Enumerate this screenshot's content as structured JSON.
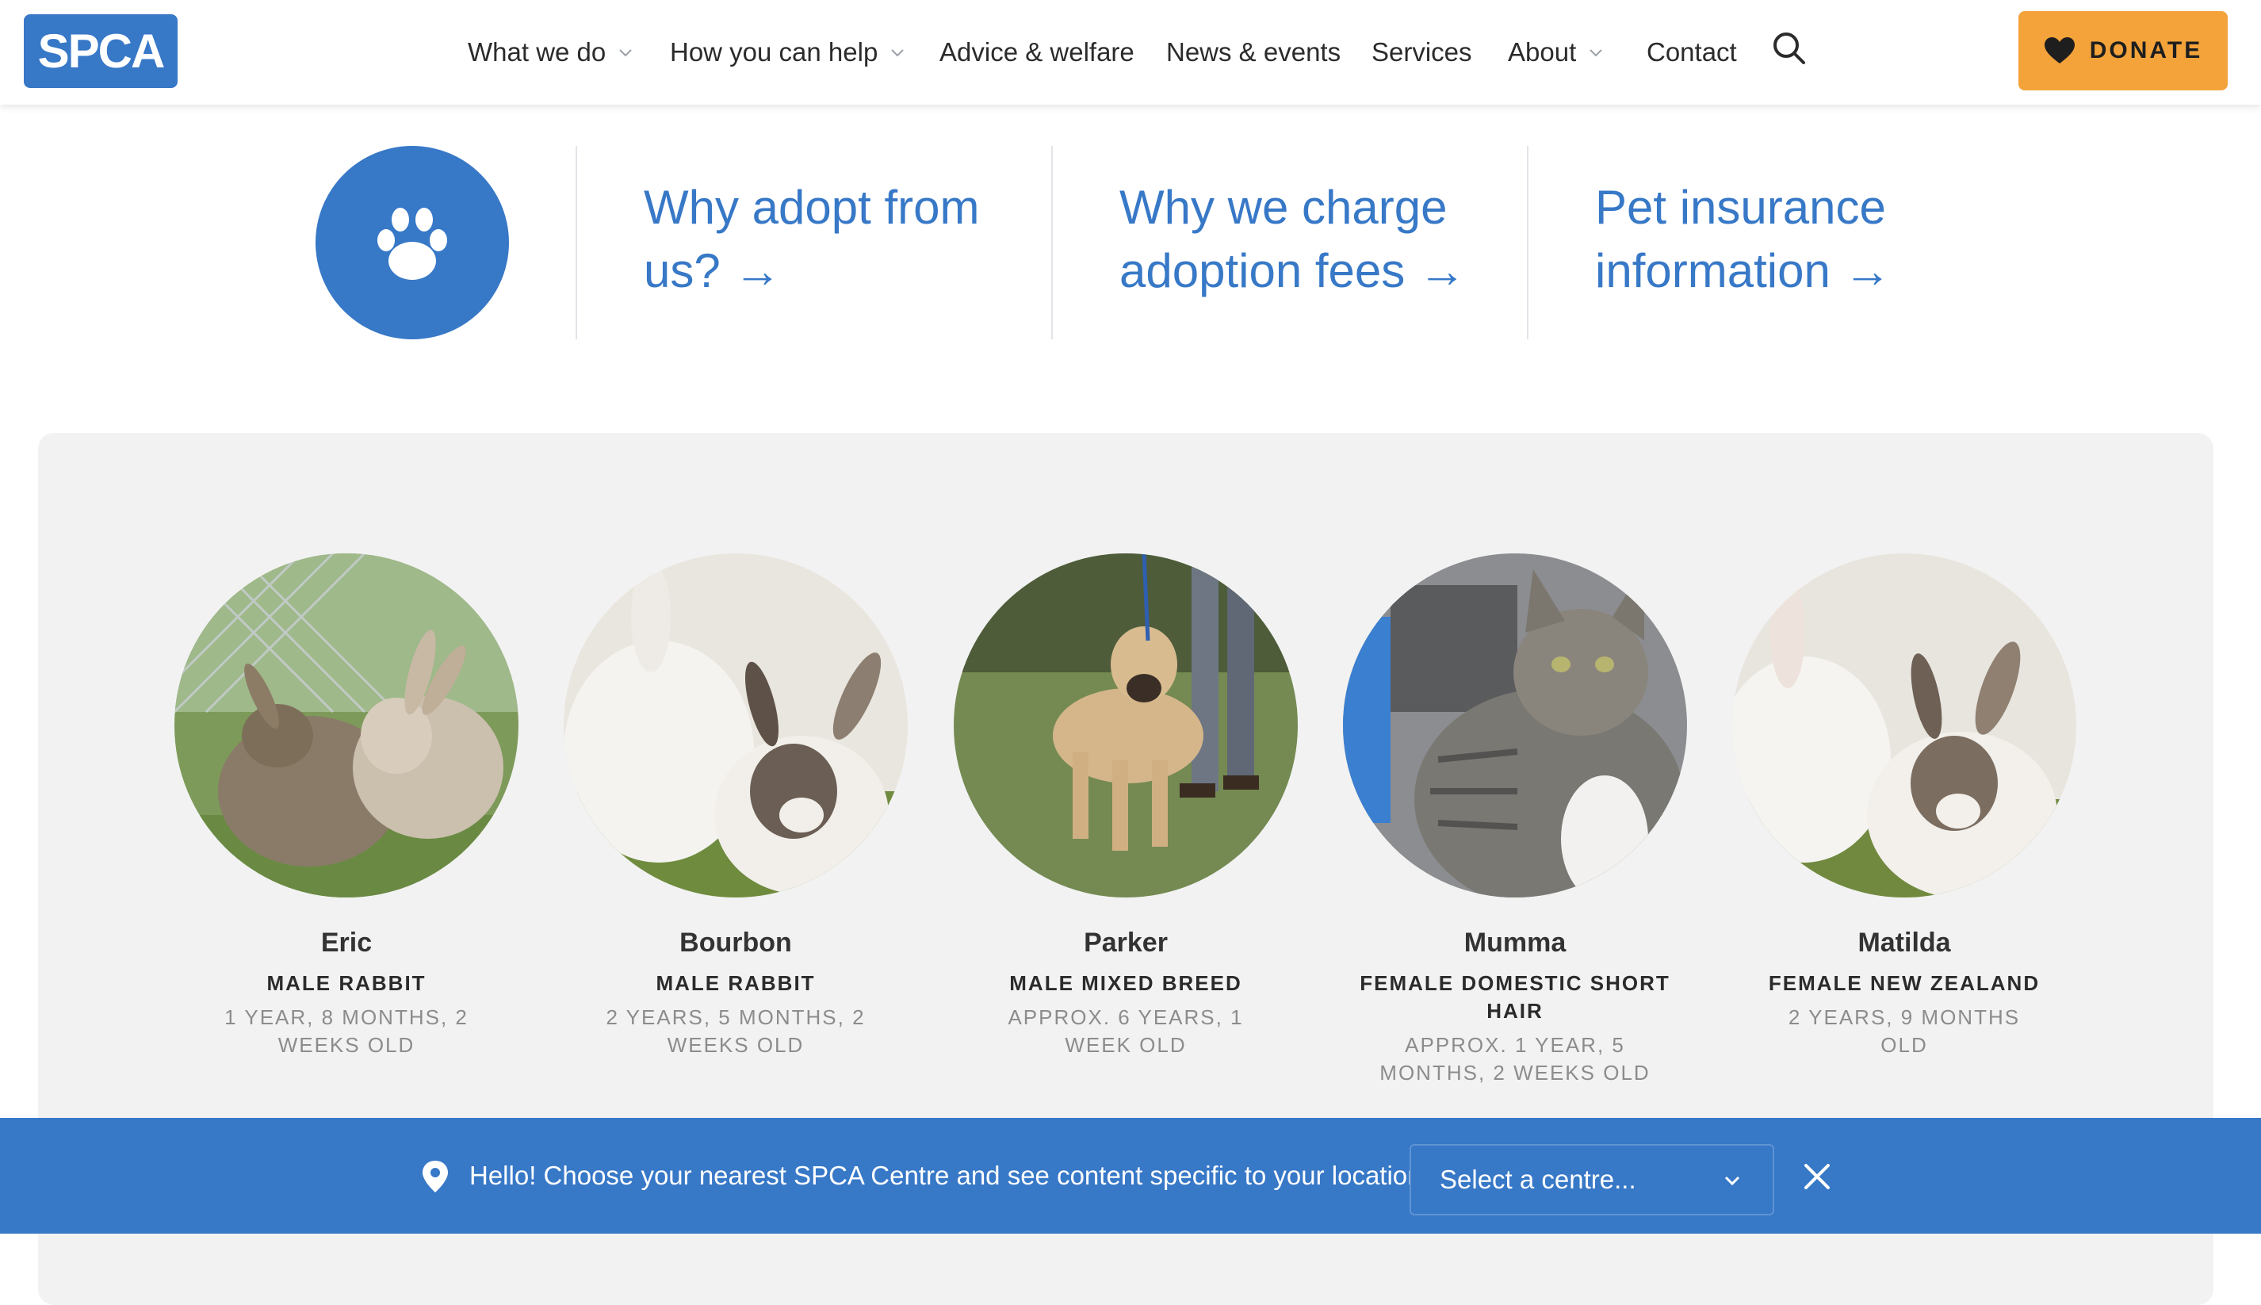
{
  "brand": {
    "logo_text": "SPCA",
    "color_primary": "#3778c7",
    "color_donate": "#f3a33a"
  },
  "nav": {
    "items": [
      {
        "label": "What we do",
        "has_dropdown": true
      },
      {
        "label": "How you can help",
        "has_dropdown": true
      },
      {
        "label": "Advice & welfare",
        "has_dropdown": false
      },
      {
        "label": "News & events",
        "has_dropdown": false
      },
      {
        "label": "Services",
        "has_dropdown": false
      },
      {
        "label": "About",
        "has_dropdown": true
      },
      {
        "label": "Contact",
        "has_dropdown": false
      }
    ],
    "search_icon": "search-icon",
    "donate_label": "DONATE",
    "donate_icon": "heart-icon"
  },
  "quick_links": {
    "icon": "paw-icon",
    "links": [
      {
        "line1": "Why adopt from",
        "line2": "us? →"
      },
      {
        "line1": "Why we charge",
        "line2": "adoption fees →"
      },
      {
        "line1": "Pet insurance",
        "line2": "information →"
      }
    ]
  },
  "pets": [
    {
      "name": "Eric",
      "breed": "Male Rabbit",
      "age": "1 year, 8 months, 2 weeks old"
    },
    {
      "name": "Bourbon",
      "breed": "Male Rabbit",
      "age": "2 years, 5 months, 2 weeks old"
    },
    {
      "name": "Parker",
      "breed": "Male Mixed Breed",
      "age": "Approx. 6 years, 1 week old"
    },
    {
      "name": "Mumma",
      "breed": "Female Domestic Short Hair",
      "age": "Approx. 1 year, 5 months, 2 weeks old"
    },
    {
      "name": "Matilda",
      "breed": "Female New Zealand",
      "age": "2 years, 9 months old"
    }
  ],
  "location_bar": {
    "message": "Hello! Choose your nearest SPCA Centre and see content specific to your location:",
    "select_value": "Select a centre...",
    "pin_icon": "location-pin-icon",
    "close_icon": "close-icon"
  }
}
